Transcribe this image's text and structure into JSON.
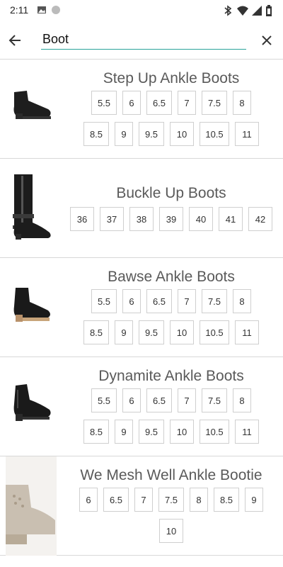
{
  "status_bar": {
    "time": "2:11",
    "icons": [
      "image-icon",
      "circle-icon",
      "bluetooth-icon",
      "wifi-icon",
      "signal-icon",
      "battery-icon"
    ]
  },
  "search": {
    "value": "Boot",
    "back_icon": "arrow-left-icon",
    "clear_icon": "close-icon",
    "accent_color": "#2aa39a"
  },
  "products": [
    {
      "name": "Step Up Ankle Boots",
      "sizes": [
        "5.5",
        "6",
        "6.5",
        "7",
        "7.5",
        "8",
        "8.5",
        "9",
        "9.5",
        "10",
        "10.5",
        "11"
      ]
    },
    {
      "name": "Buckle Up Boots",
      "sizes": [
        "36",
        "37",
        "38",
        "39",
        "40",
        "41",
        "42"
      ]
    },
    {
      "name": "Bawse Ankle Boots",
      "sizes": [
        "5.5",
        "6",
        "6.5",
        "7",
        "7.5",
        "8",
        "8.5",
        "9",
        "9.5",
        "10",
        "10.5",
        "11"
      ]
    },
    {
      "name": "Dynamite Ankle Boots",
      "sizes": [
        "5.5",
        "6",
        "6.5",
        "7",
        "7.5",
        "8",
        "8.5",
        "9",
        "9.5",
        "10",
        "10.5",
        "11"
      ]
    },
    {
      "name": "We Mesh Well Ankle Bootie",
      "sizes": [
        "6",
        "6.5",
        "7",
        "7.5",
        "8",
        "8.5",
        "9",
        "10"
      ]
    }
  ]
}
